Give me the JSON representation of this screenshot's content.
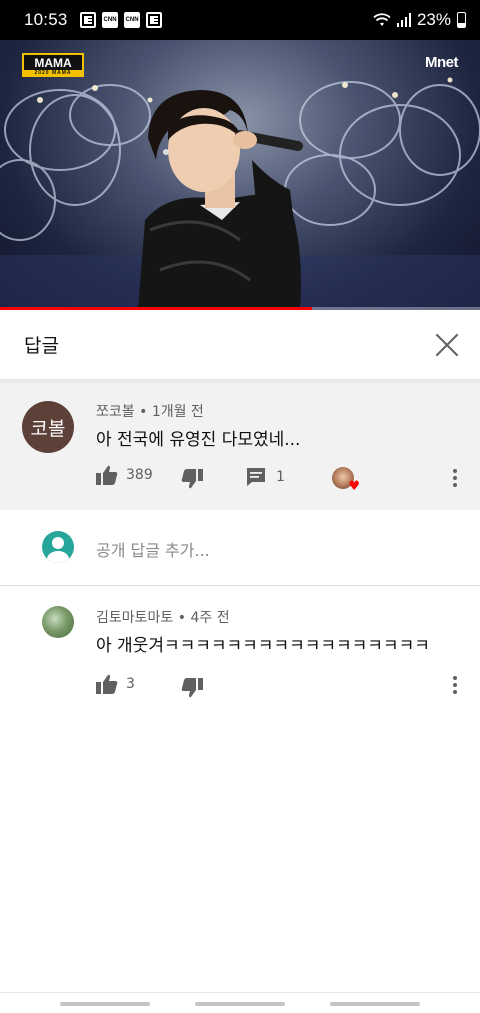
{
  "status_bar": {
    "time": "10:53",
    "notification_icons": [
      "news-icon",
      "cnn-icon",
      "cnn-icon",
      "news-icon"
    ],
    "cnn_label": "CNN",
    "battery": "23%"
  },
  "video": {
    "channel_logo": "MAMA",
    "channel_logo_sub": "2020 MAMA",
    "broadcaster_logo": "Mnet",
    "progress": 0.65
  },
  "replies": {
    "title": "답글",
    "parent_comment": {
      "avatar_text": "코볼",
      "author": "쪼코볼",
      "time": "1개월 전",
      "text": "아 전국에 유영진 다모였네...",
      "likes": "389",
      "replies": "1",
      "creator_heart": true
    },
    "add_reply_placeholder": "공개 답글 추가...",
    "items": [
      {
        "author": "김토마토마토",
        "time": "4주 전",
        "text": "아 개웃겨ㅋㅋㅋㅋㅋㅋㅋㅋㅋㅋㅋㅋㅋㅋㅋㅋㅋ",
        "likes": "3"
      }
    ]
  },
  "colors": {
    "progress": "#ff0000",
    "parent_background": "#f2f2f2",
    "avatar_brown": "#5d4037",
    "my_avatar": "#26a69a"
  }
}
